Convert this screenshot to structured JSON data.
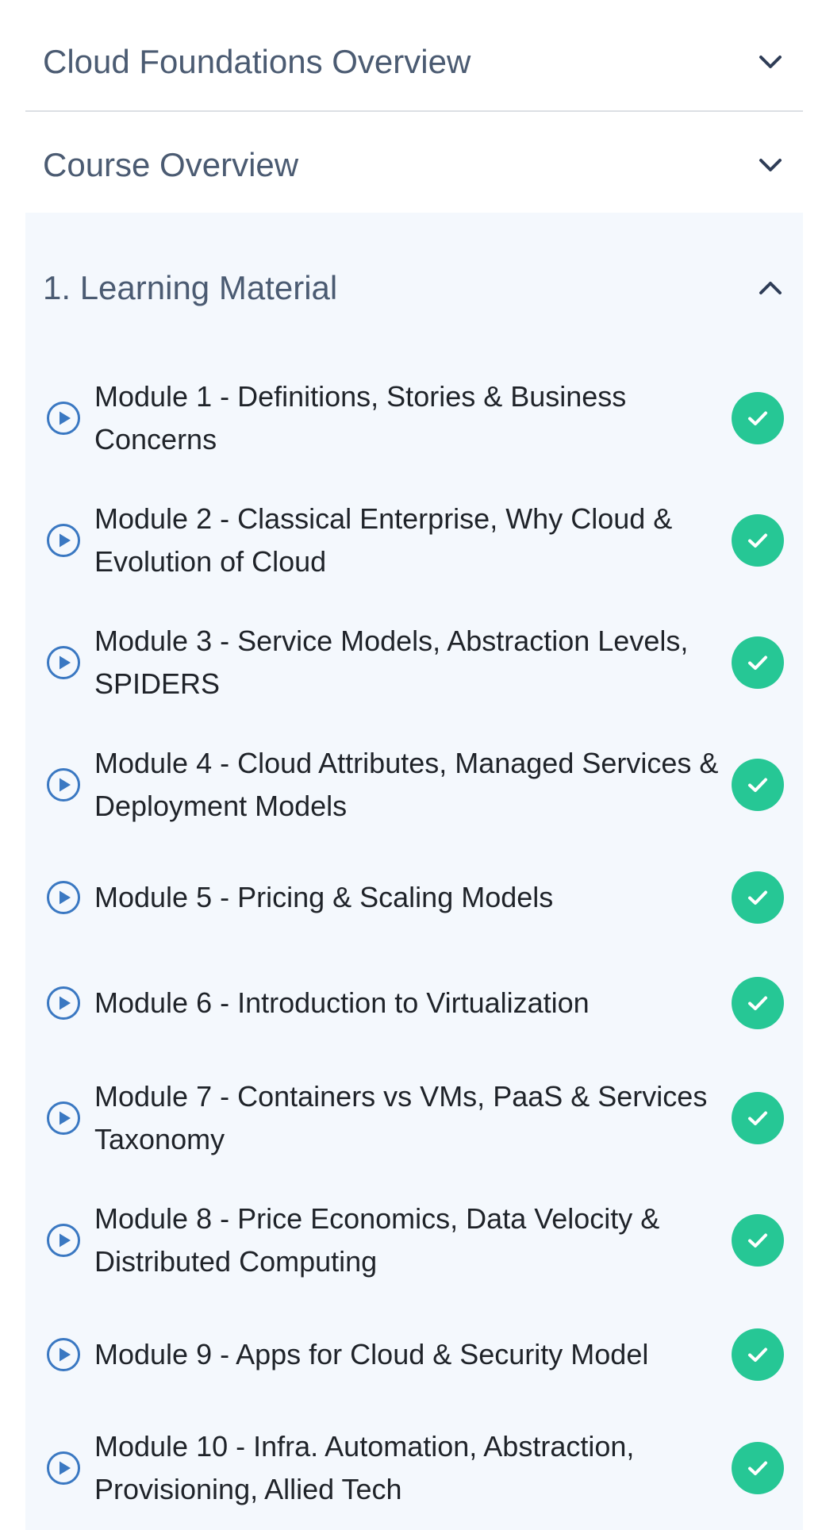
{
  "sections": [
    {
      "title": "Cloud Foundations Overview",
      "expanded": false
    },
    {
      "title": "Course Overview",
      "expanded": false
    },
    {
      "title": "1. Learning Material",
      "expanded": true
    }
  ],
  "modules": [
    {
      "label": "Module 1 - Definitions, Stories & Business Concerns",
      "completed": true
    },
    {
      "label": "Module 2 - Classical Enterprise, Why Cloud & Evolution of Cloud",
      "completed": true
    },
    {
      "label": "Module 3 - Service Models, Abstraction Levels, SPIDERS",
      "completed": true
    },
    {
      "label": "Module 4 - Cloud Attributes, Managed Services & Deployment Models",
      "completed": true
    },
    {
      "label": "Module 5 - Pricing & Scaling Models",
      "completed": true
    },
    {
      "label": "Module 6 - Introduction to Virtualization",
      "completed": true
    },
    {
      "label": "Module 7 - Containers vs VMs, PaaS & Services Taxonomy",
      "completed": true
    },
    {
      "label": "Module 8 - Price Economics, Data Velocity & Distributed Computing",
      "completed": true
    },
    {
      "label": "Module 9 - Apps for Cloud & Security Model",
      "completed": true
    },
    {
      "label": "Module 10 - Infra. Automation, Abstraction, Provisioning, Allied Tech",
      "completed": true
    }
  ],
  "icons": {
    "collapsed": "chevron-down-icon",
    "expanded": "chevron-up-icon",
    "module": "play-circle-icon",
    "status": "check-circle-icon"
  },
  "colors": {
    "accent_blue": "#3a78c2",
    "completed_green": "#26c795",
    "section_background": "#f4f8fd",
    "header_text": "#4b5b72",
    "chevron": "#2f3d57"
  }
}
